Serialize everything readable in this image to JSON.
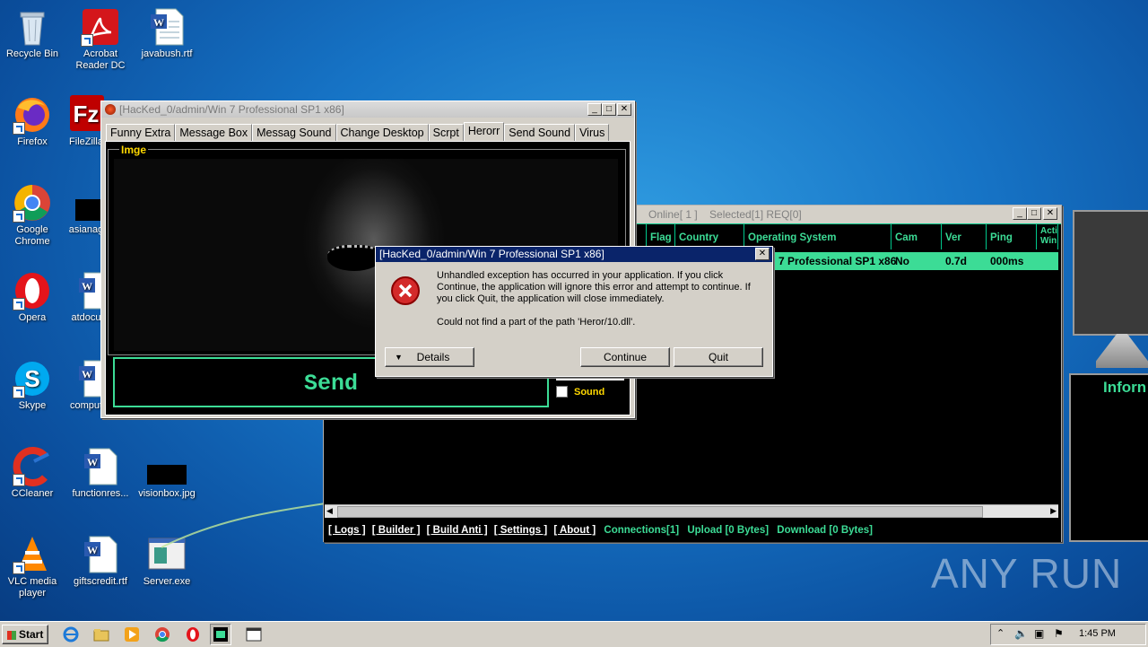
{
  "desktop": {
    "icons": [
      {
        "label": "Recycle Bin",
        "icon": "recycle-bin-icon"
      },
      {
        "label": "Acrobat\nReader DC",
        "icon": "acrobat-icon"
      },
      {
        "label": "javabush.rtf",
        "icon": "word-doc-icon"
      },
      {
        "label": "Firefox",
        "icon": "firefox-icon"
      },
      {
        "label": "FileZilla",
        "icon": "filezilla-icon"
      },
      {
        "label": "Google\nChrome",
        "icon": "chrome-icon"
      },
      {
        "label": "asianag",
        "icon": "black-file-icon"
      },
      {
        "label": "Opera",
        "icon": "opera-icon"
      },
      {
        "label": "atdocu",
        "icon": "word-doc-icon"
      },
      {
        "label": "Skype",
        "icon": "skype-icon"
      },
      {
        "label": "comput",
        "icon": "word-doc-icon"
      },
      {
        "label": "CCleaner",
        "icon": "ccleaner-icon"
      },
      {
        "label": "functionres...",
        "icon": "word-doc-icon"
      },
      {
        "label": "visionbox.jpg",
        "icon": "image-file-icon"
      },
      {
        "label": "VLC media\nplayer",
        "icon": "vlc-icon"
      },
      {
        "label": "giftscredit.rtf",
        "icon": "word-doc-icon"
      },
      {
        "label": "Server.exe",
        "icon": "exe-icon"
      }
    ],
    "watermark": "ANY RUN",
    "side_panel_title": "Inforn"
  },
  "rat_window": {
    "title": "[HacKed_0/admin/Win 7 Professional SP1 x86]",
    "tabs": [
      "Funny Extra",
      "Message Box",
      "Messag Sound",
      "Change Desktop",
      "Scrpt",
      "Herorr",
      "Send Sound",
      "Virus"
    ],
    "selected_tab": "Herorr",
    "group_label": "Imge",
    "send_label": "Send",
    "sound_label": "Sound"
  },
  "main_window": {
    "status": "Online[ 1 ]    Selected[1] REQ[0]",
    "columns": [
      "Flag",
      "Country",
      "Operating System",
      "Cam",
      "Ver",
      "Ping",
      "Acti Win"
    ],
    "row": {
      "os": "7 Professional SP1 x86",
      "cam": "No",
      "ver": "0.7d",
      "ping": "000ms"
    },
    "bottom_links": [
      "[ Logs ]",
      "[ Builder ]",
      "[ Build Anti ]",
      "[ Settings ]",
      "[ About ]"
    ],
    "bottom_status": [
      "Connections[1]",
      "Upload [0 Bytes]",
      "Download [0 Bytes]"
    ]
  },
  "error_dialog": {
    "title": "[HacKed_0/admin/Win 7 Professional SP1 x86]",
    "message": "Unhandled exception has occurred in your application. If you click Continue, the application will ignore this error and attempt to continue. If you click Quit, the application will close immediately.",
    "detail": "Could not find a part of the path 'Heror/10.dll'.",
    "details_button": "Details",
    "continue_button": "Continue",
    "quit_button": "Quit"
  },
  "taskbar": {
    "start_label": "Start",
    "clock": "1:45 PM"
  }
}
